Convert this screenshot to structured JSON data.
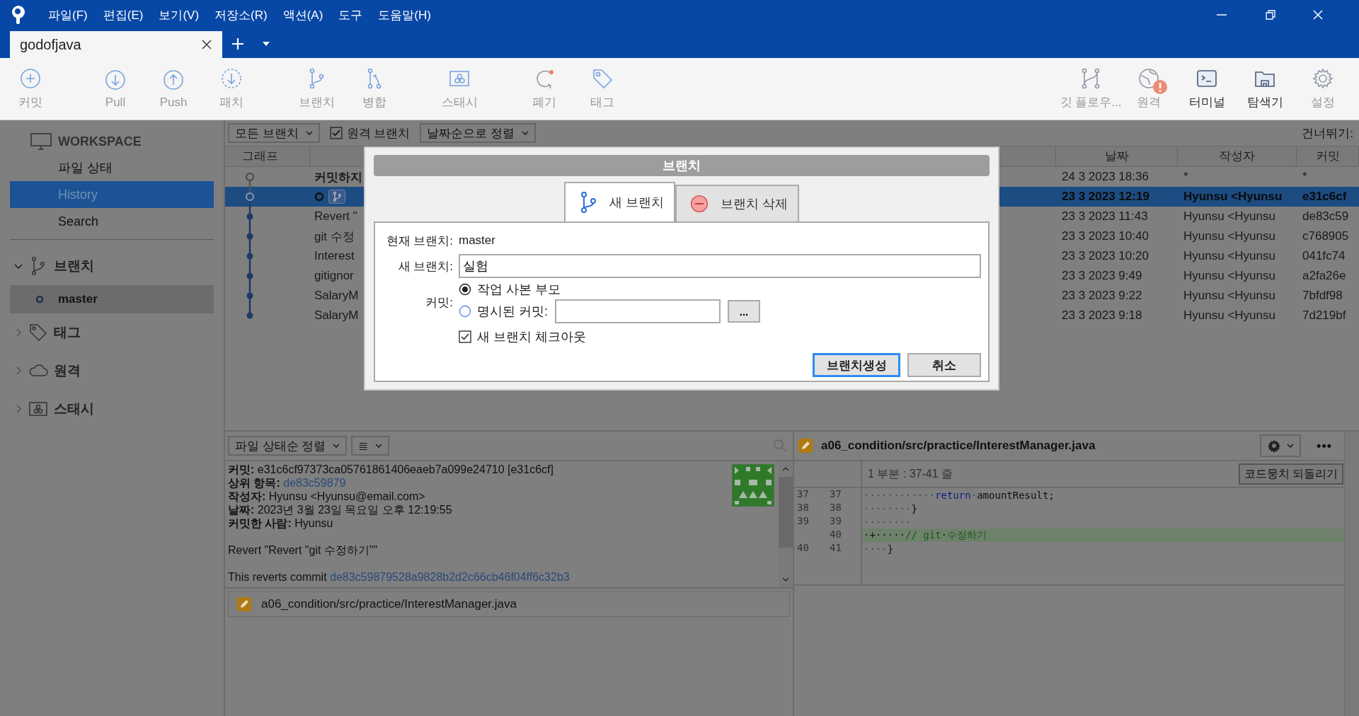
{
  "menu": [
    "파일(F)",
    "편집(E)",
    "보기(V)",
    "저장소(R)",
    "액션(A)",
    "도구",
    "도움말(H)"
  ],
  "tabs": [
    {
      "label": "godofjava",
      "selected": true
    }
  ],
  "toolbar": {
    "left": [
      {
        "label": "커밋",
        "kind": "commit",
        "disabled": true
      },
      {
        "label": "Pull",
        "kind": "pull",
        "disabled": true
      },
      {
        "label": "Push",
        "kind": "push",
        "disabled": true
      },
      {
        "label": "패치",
        "kind": "fetch",
        "disabled": true
      },
      {
        "label": "브랜치",
        "kind": "branch",
        "disabled": true
      },
      {
        "label": "병합",
        "kind": "merge",
        "disabled": true
      },
      {
        "label": "스태시",
        "kind": "stash",
        "disabled": true
      },
      {
        "label": "폐기",
        "kind": "discard",
        "disabled": true
      },
      {
        "label": "태그",
        "kind": "tag",
        "disabled": true
      }
    ],
    "right": [
      {
        "label": "깃 플로우...",
        "kind": "gitflow",
        "disabled": true,
        "alert": false
      },
      {
        "label": "원격",
        "kind": "remote",
        "disabled": true,
        "alert": true
      },
      {
        "label": "터미널",
        "kind": "terminal",
        "disabled": false,
        "alert": false
      },
      {
        "label": "탐색기",
        "kind": "explorer",
        "disabled": false,
        "alert": false
      },
      {
        "label": "설정",
        "kind": "settings",
        "disabled": true,
        "alert": false
      }
    ]
  },
  "sidebar": {
    "workspace": "WORKSPACE",
    "items": [
      {
        "label": "파일 상태",
        "selected": false
      },
      {
        "label": "History",
        "selected": true
      },
      {
        "label": "Search",
        "selected": false
      }
    ],
    "sections": [
      {
        "label": "브랜치",
        "kind": "branch",
        "expanded": true,
        "children": [
          {
            "label": "master",
            "selected": true
          }
        ]
      },
      {
        "label": "태그",
        "kind": "tag",
        "expanded": false
      },
      {
        "label": "원격",
        "kind": "remote",
        "expanded": false
      },
      {
        "label": "스태시",
        "kind": "stash",
        "expanded": false
      }
    ]
  },
  "filter_bar": {
    "branches": "모든 브랜치",
    "remote_branches": {
      "label": "원격 브랜치",
      "checked": true
    },
    "sort": "날짜순으로 정렬",
    "skip": "건너뛰기:"
  },
  "table": {
    "columns": {
      "graph": "그래프",
      "date": "날짜",
      "author": "작성자",
      "commit": "커밋"
    },
    "rows": [
      {
        "kind": "uncommitted",
        "description": "커밋하지",
        "date": "24 3 2023 18:36",
        "author": "*",
        "commit": "*",
        "selected": false
      },
      {
        "kind": "head",
        "date": "23 3 2023 12:19",
        "author": "Hyunsu <Hyunsu",
        "commit": "e31c6cf",
        "selected": true
      },
      {
        "kind": "commit",
        "description": "Revert \"",
        "date": "23 3 2023 11:43",
        "author": "Hyunsu <Hyunsu",
        "commit": "de83c59",
        "selected": false
      },
      {
        "kind": "commit",
        "description": "git 수정",
        "date": "23 3 2023 10:40",
        "author": "Hyunsu <Hyunsu",
        "commit": "c768905",
        "selected": false
      },
      {
        "kind": "commit",
        "description": "Interest",
        "date": "23 3 2023 10:20",
        "author": "Hyunsu <Hyunsu",
        "commit": "041fc74",
        "selected": false
      },
      {
        "kind": "commit",
        "description": "gitignor",
        "date": "23 3 2023 9:49",
        "author": "Hyunsu <Hyunsu",
        "commit": "a2fa26e",
        "selected": false
      },
      {
        "kind": "commit",
        "description": "SalaryM",
        "date": "23 3 2023 9:22",
        "author": "Hyunsu <Hyunsu",
        "commit": "7bfdf98",
        "selected": false
      },
      {
        "kind": "commit",
        "description": "SalaryM",
        "date": "23 3 2023 9:18",
        "author": "Hyunsu <Hyunsu",
        "commit": "7d219bf",
        "selected": false
      }
    ]
  },
  "dialog": {
    "title": "브랜치",
    "tabs": [
      {
        "label": "새 브랜치",
        "kind": "new",
        "selected": true
      },
      {
        "label": "브랜치 삭제",
        "kind": "delete",
        "selected": false
      }
    ],
    "current_branch": {
      "label": "현재 브랜치:",
      "value": "master"
    },
    "new_branch": {
      "label": "새 브랜치:",
      "value": "실험"
    },
    "commit": {
      "label": "커밋:",
      "options": [
        {
          "label": "작업 사본 부모",
          "kind": "parent",
          "selected": true
        },
        {
          "label": "명시된 커밋:",
          "kind": "specified",
          "selected": false
        }
      ],
      "browse": "..."
    },
    "checkout": {
      "label": "새 브랜치 체크아웃",
      "checked": true
    },
    "buttons": [
      {
        "label": "브랜치생성",
        "primary": true
      },
      {
        "label": "취소",
        "primary": false
      }
    ]
  },
  "details": {
    "sort": "파일 상태순 정렬",
    "view": "≣",
    "fields": [
      {
        "label": "커밋:",
        "value": "e31c6cf97373ca05761861406eaeb7a099e24710 [e31c6cf]",
        "link": false
      },
      {
        "label": "상위 항목:",
        "value": "de83c59879",
        "link": true
      },
      {
        "label": "작성자:",
        "value": "Hyunsu <Hyunsu@email.com>",
        "link": false
      },
      {
        "label": "날짜:",
        "value": "2023년 3월 23일 목요일 오후 12:19:55",
        "link": false
      },
      {
        "label": "커밋한 사람:",
        "value": "Hyunsu",
        "link": false
      }
    ],
    "message": "Revert \"Revert \"git 수정하기\"\"",
    "reverts": {
      "text": "This reverts commit",
      "link": "de83c59879528a9828b2d2c66cb46f04ff6c32b3"
    },
    "files": [
      {
        "path": "a06_condition/src/practice/InterestManager.java"
      }
    ]
  },
  "diff": {
    "file": "a06_condition/src/practice/InterestManager.java",
    "more": "•••",
    "hunk": "1 부분 : 37-41 줄",
    "revert": "코드뭉치 되돌리기",
    "lines": [
      {
        "old": "37",
        "new": "37",
        "kind": "context",
        "segments": [
          {
            "text": "············",
            "kind": "space"
          },
          {
            "text": "return",
            "kind": "keyword"
          },
          {
            "text": "·",
            "kind": "space"
          },
          {
            "text": "amountResult;",
            "kind": "plain"
          }
        ]
      },
      {
        "old": "38",
        "new": "38",
        "kind": "context",
        "segments": [
          {
            "text": "········",
            "kind": "space"
          },
          {
            "text": "}",
            "kind": "plain"
          }
        ]
      },
      {
        "old": "39",
        "new": "39",
        "kind": "context",
        "segments": [
          {
            "text": "········",
            "kind": "space"
          }
        ]
      },
      {
        "new": "40",
        "kind": "added",
        "segments": [
          {
            "text": "·",
            "kind": "space"
          },
          {
            "text": "+",
            "kind": "plain"
          },
          {
            "text": "·····",
            "kind": "space"
          },
          {
            "text": "// git",
            "kind": "comment"
          },
          {
            "text": "·",
            "kind": "space"
          },
          {
            "text": "수정하기",
            "kind": "comment"
          }
        ]
      },
      {
        "old": "40",
        "new": "41",
        "kind": "context",
        "segments": [
          {
            "text": "····",
            "kind": "space"
          },
          {
            "text": "}",
            "kind": "plain"
          }
        ]
      }
    ]
  }
}
